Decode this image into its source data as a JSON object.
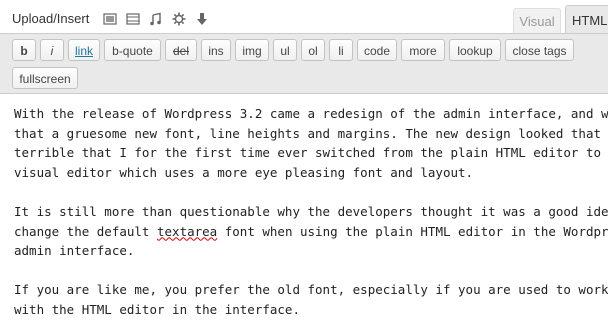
{
  "header": {
    "upload_label": "Upload/Insert",
    "media_icons": [
      "image-icon",
      "video-icon",
      "audio-icon",
      "media-gear-icon",
      "download-icon"
    ],
    "tabs": {
      "visual": "Visual",
      "html": "HTML"
    }
  },
  "toolbar": {
    "buttons": [
      {
        "id": "b",
        "label": "b"
      },
      {
        "id": "i",
        "label": "i"
      },
      {
        "id": "link",
        "label": "link"
      },
      {
        "id": "b-quote",
        "label": "b-quote"
      },
      {
        "id": "del",
        "label": "del"
      },
      {
        "id": "ins",
        "label": "ins"
      },
      {
        "id": "img",
        "label": "img"
      },
      {
        "id": "ul",
        "label": "ul"
      },
      {
        "id": "ol",
        "label": "ol"
      },
      {
        "id": "li",
        "label": "li"
      },
      {
        "id": "code",
        "label": "code"
      },
      {
        "id": "more",
        "label": "more"
      },
      {
        "id": "lookup",
        "label": "lookup"
      },
      {
        "id": "close-tags",
        "label": "close tags"
      },
      {
        "id": "fullscreen",
        "label": "fullscreen"
      }
    ]
  },
  "editor": {
    "p1": [
      "With the release of Wordpress 3.2 came a redesign of the admin interface, and with",
      "that a gruesome new font, line heights and margins. The new design looked that",
      "terrible that I for the first time ever switched from the plain HTML editor to the",
      "visual editor which uses a more eye pleasing font and layout."
    ],
    "p2": {
      "line1": "It is still more than questionable why the developers thought it was a good idea to",
      "line2_before": "change the default ",
      "line2_word": "textarea",
      "line2_after": " font when using the plain HTML editor in the Wordpress",
      "line3": "admin interface."
    },
    "p3": [
      "If you are like me, you prefer the old font, especially if you are used to working",
      "with the HTML editor in the interface."
    ]
  },
  "colors": {
    "toolbar_bg": "#e9e9e9",
    "link_blue": "#21759b",
    "spellcheck_red": "#d00000"
  }
}
